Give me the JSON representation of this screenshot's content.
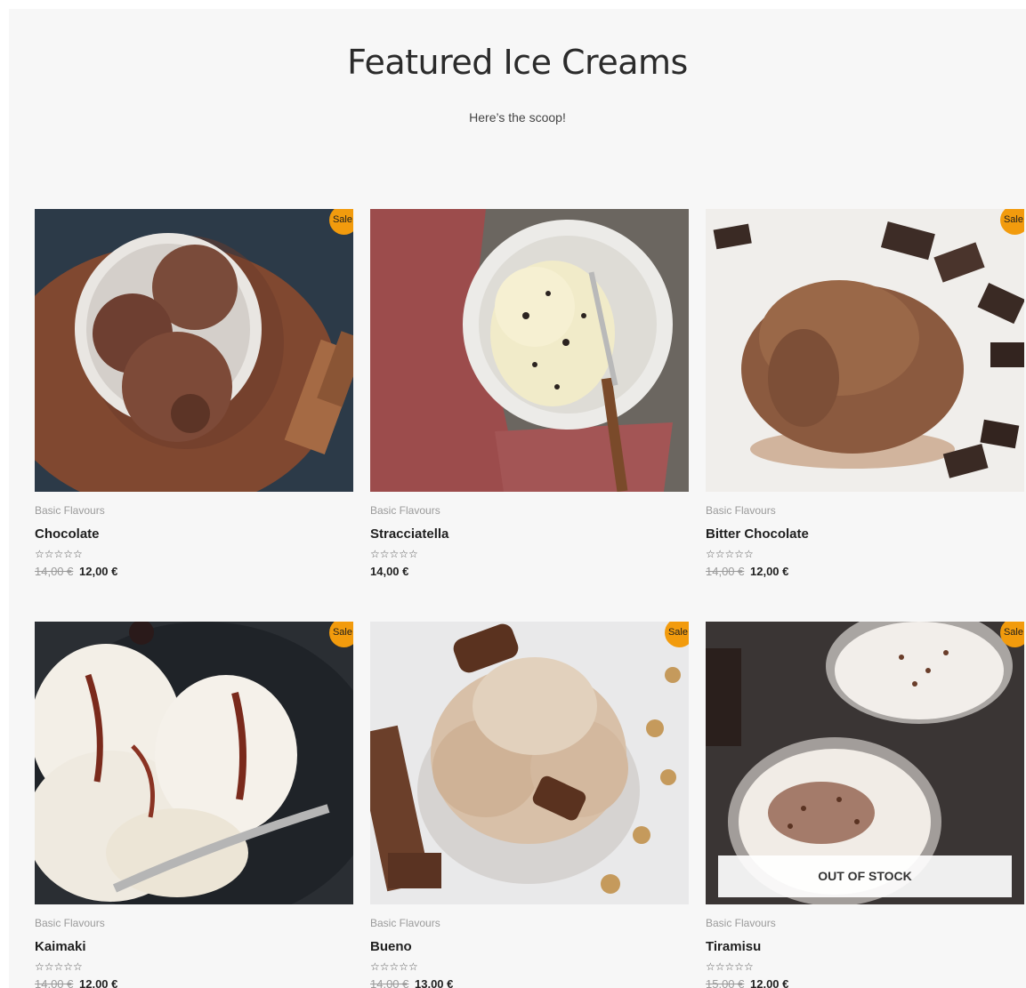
{
  "section": {
    "title": "Featured Ice Creams",
    "subtitle": "Here’s the scoop!"
  },
  "colors": {
    "sale_badge": "#f29b0d",
    "background": "#f7f7f7"
  },
  "products": [
    {
      "category": "Basic Flavours",
      "name": "Chocolate",
      "rating_stars": "☆☆☆☆☆",
      "old_price": "14,00 €",
      "price": "12,00 €",
      "sale_label": "Sale!",
      "image": "chocolate-scoops-photo"
    },
    {
      "category": "Basic Flavours",
      "name": "Stracciatella",
      "rating_stars": "☆☆☆☆☆",
      "old_price": "",
      "price": "14,00 €",
      "sale_label": "",
      "image": "stracciatella-bowl-photo"
    },
    {
      "category": "Basic Flavours",
      "name": "Bitter Chocolate",
      "rating_stars": "☆☆☆☆☆",
      "old_price": "14,00 €",
      "price": "12,00 €",
      "sale_label": "Sale!",
      "image": "bitter-chocolate-scoop-photo"
    },
    {
      "category": "Basic Flavours",
      "name": "Kaimaki",
      "rating_stars": "☆☆☆☆☆",
      "old_price": "14,00 €",
      "price": "12,00 €",
      "sale_label": "Sale!",
      "image": "kaimaki-scoops-photo"
    },
    {
      "category": "Basic Flavours",
      "name": "Bueno",
      "rating_stars": "☆☆☆☆☆",
      "old_price": "14,00 €",
      "price": "13,00 €",
      "sale_label": "Sale!",
      "image": "bueno-glass-photo"
    },
    {
      "category": "Basic Flavours",
      "name": "Tiramisu",
      "rating_stars": "☆☆☆☆☆",
      "old_price": "15,00 €",
      "price": "12,00 €",
      "sale_label": "Sale!",
      "out_of_stock_label": "OUT OF STOCK",
      "image": "tiramisu-cups-photo"
    }
  ]
}
